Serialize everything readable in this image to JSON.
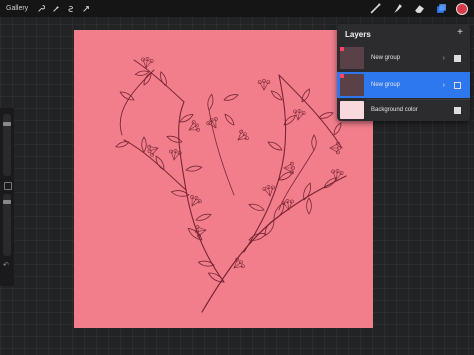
{
  "topbar": {
    "gallery_label": "Gallery",
    "left_tools": [
      "wrench-icon",
      "magic-wand-icon",
      "selection-icon",
      "transform-arrow-icon"
    ],
    "right_tools": [
      "brush-icon",
      "smudge-icon",
      "eraser-icon",
      "layers-icon"
    ],
    "current_color": "#d93a4a"
  },
  "canvas": {
    "background_color": "#f27e8c",
    "stroke_color": "#7a2634"
  },
  "layers_panel": {
    "title": "Layers",
    "add_symbol": "+",
    "rows": [
      {
        "label": "New group",
        "active": false,
        "visible": true
      },
      {
        "label": "New group",
        "active": true,
        "visible": false
      },
      {
        "label": "Background color",
        "active": false,
        "visible": true
      }
    ],
    "chevron": "›"
  },
  "sidebar": {
    "undo_symbol": "↶"
  },
  "colors": {
    "accent": "#2d78ee",
    "panel": "#2c2c2e"
  }
}
